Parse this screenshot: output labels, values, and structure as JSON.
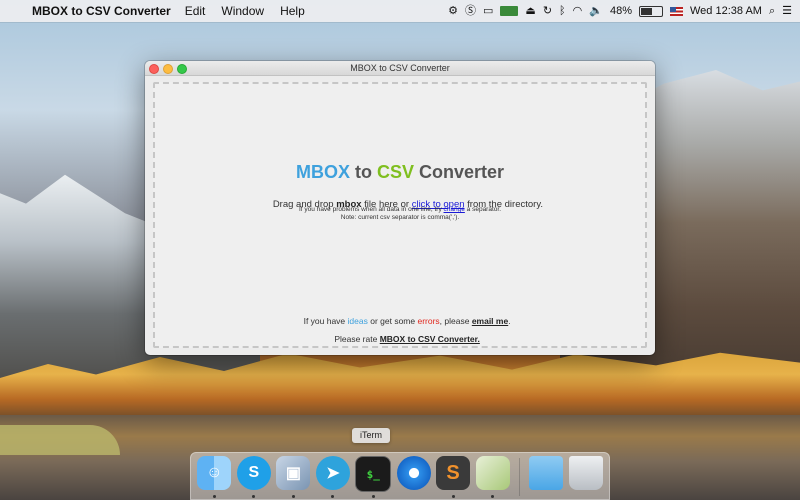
{
  "menubar": {
    "app_name": "MBOX to CSV Converter",
    "items": [
      "Edit",
      "Window",
      "Help"
    ],
    "battery": "48%",
    "clock": "Wed 12:38 AM"
  },
  "window": {
    "title": "MBOX to CSV Converter",
    "headline": {
      "part1": "MBOX",
      "part2": " to ",
      "part3": "CSV",
      "part4": " Converter"
    },
    "subline": {
      "pre": "Drag and drop ",
      "bold": "mbox",
      "mid": " file here or ",
      "link": "click to open",
      "post": " from the directory."
    },
    "hint": {
      "line1_pre": "If you have problems when all data in one line, try ",
      "line1_link": "change",
      "line1_post": " a separator.",
      "line2": "Note: current csv separator is comma(',')."
    },
    "feedback": {
      "pre": "If you have ",
      "ideas": "ideas",
      "mid": " or get some ",
      "errors": "errors",
      "post": ", please ",
      "email": "email me",
      "end": "."
    },
    "rate": {
      "pre": "Please rate ",
      "link": "MBOX to CSV Converter."
    }
  },
  "dock": {
    "tooltip": "iTerm",
    "items": [
      {
        "name": "Finder",
        "icon": "finder-icon"
      },
      {
        "name": "Skype",
        "icon": "skype-icon"
      },
      {
        "name": "Preview",
        "icon": "preview-icon"
      },
      {
        "name": "Telegram",
        "icon": "telegram-icon"
      },
      {
        "name": "iTerm",
        "icon": "iterm-icon"
      },
      {
        "name": "Safari",
        "icon": "safari-icon"
      },
      {
        "name": "Sublime Text",
        "icon": "sublime-icon"
      },
      {
        "name": "MBOX to CSV Converter",
        "icon": "mbox-csv-icon"
      },
      {
        "name": "Downloads",
        "icon": "folder-icon"
      },
      {
        "name": "Trash",
        "icon": "trash-icon"
      }
    ]
  },
  "colors": {
    "accent_blue": "#3ea1dd",
    "accent_green": "#7fbf1f",
    "error_red": "#e0281e",
    "link_blue": "#1a1ad6"
  }
}
